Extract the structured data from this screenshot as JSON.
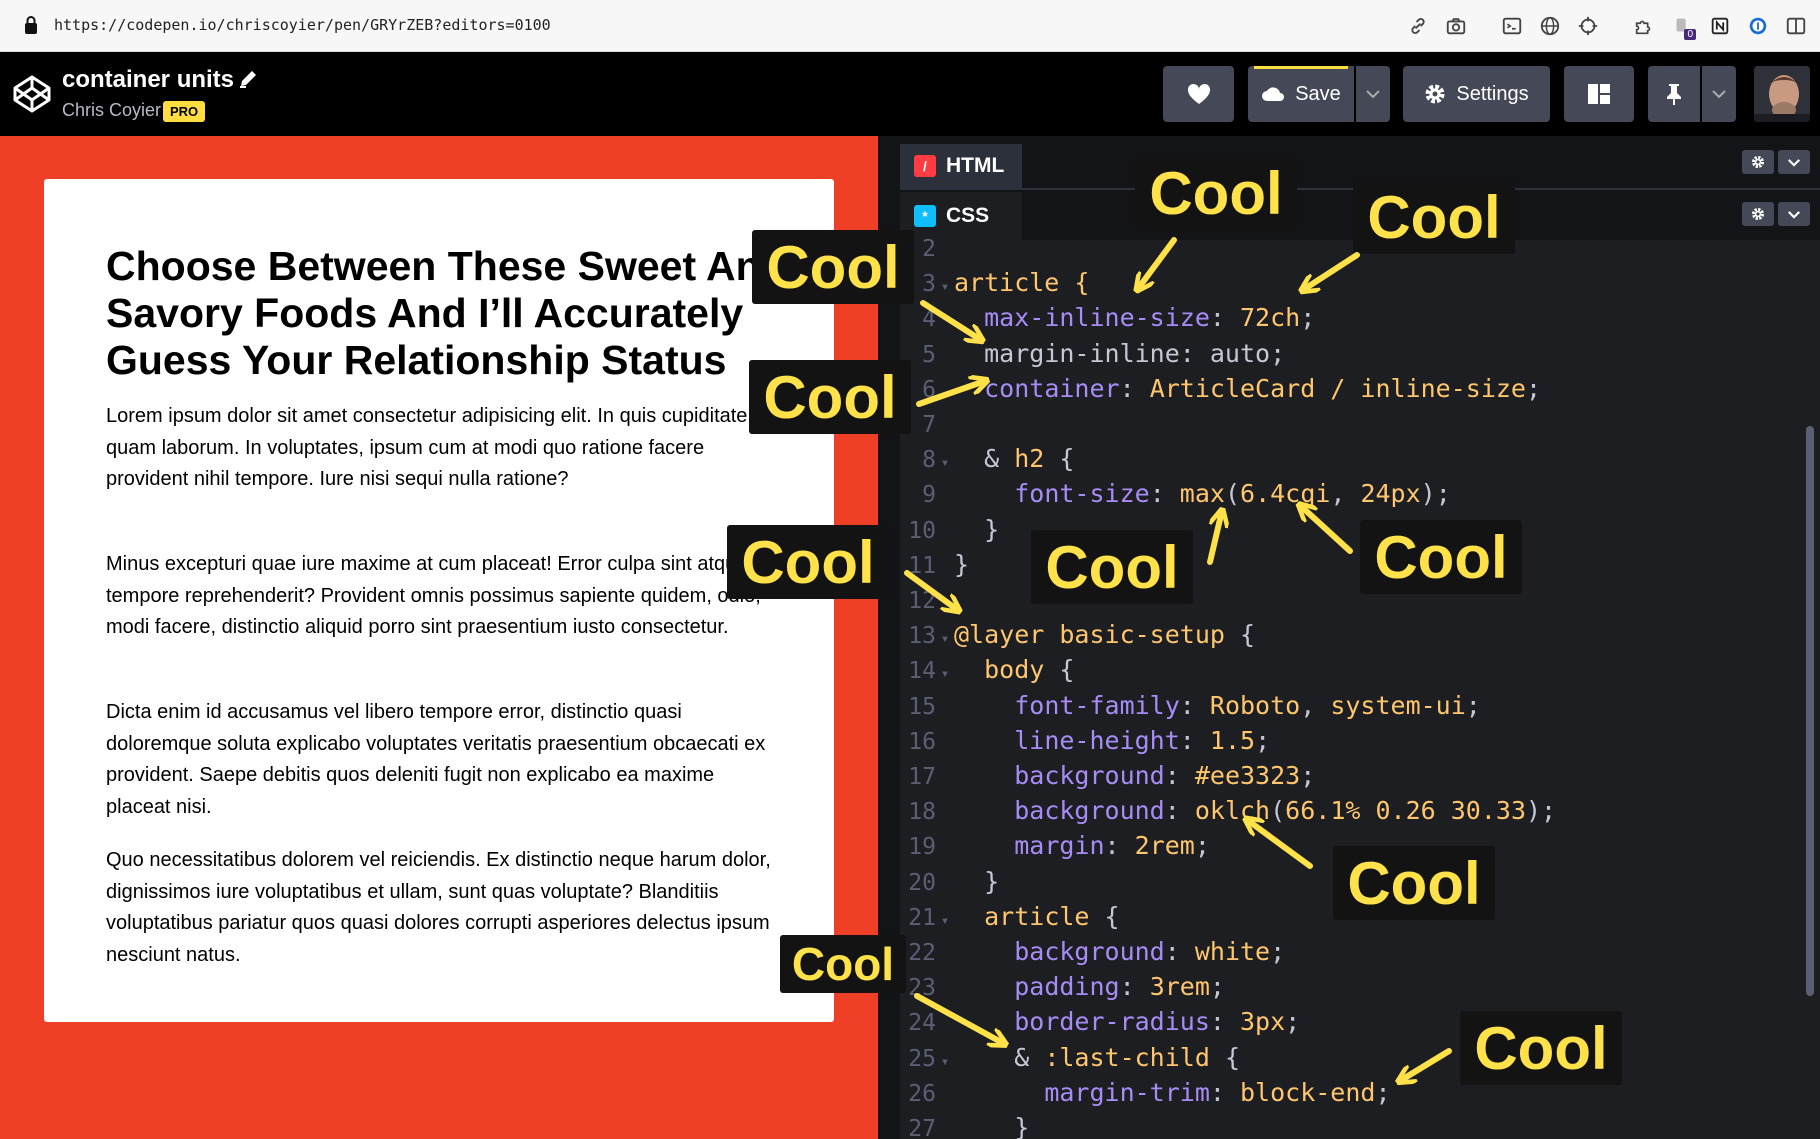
{
  "browser": {
    "url": "https://codepen.io/chriscoyier/pen/GRYrZEB?editors=0100",
    "extension_badge": "0"
  },
  "header": {
    "pen_title": "container units",
    "author": "Chris Coyier",
    "pro_badge": "PRO",
    "save_label": "Save",
    "settings_label": "Settings"
  },
  "preview": {
    "title": "Choose Between These Sweet And Savory Foods And I’ll Accurately Guess Your Relationship Status",
    "paragraphs": [
      "Lorem ipsum dolor sit amet consectetur adipisicing elit. In quis cupiditate quam laborum. In voluptates, ipsum cum at modi quo ratione facere provident nihil tempore. Iure nisi sequi nulla ratione?",
      "Minus excepturi quae iure maxime at cum placeat! Error culpa sint atque tempore reprehenderit? Provident omnis possimus sapiente quidem, odio, modi facere, distinctio aliquid porro sint praesentium iusto consectetur.",
      "Dicta enim id accusamus vel libero tempore error, distinctio quasi doloremque soluta explicabo voluptates veritatis praesentium obcaecati ex provident. Saepe debitis quos deleniti fugit non explicabo ea maxime placeat nisi.",
      "Quo necessitatibus dolorem vel reiciendis. Ex distinctio neque harum dolor, dignissimos iure voluptatibus et ullam, sunt quas voluptate? Blanditiis voluptatibus pariatur quos quasi dolores corrupti asperiores delectus ipsum nesciunt natus."
    ]
  },
  "editor": {
    "tab_html": "HTML",
    "tab_css": "CSS",
    "colors": {
      "property": "#a88cf5",
      "value": "#ffc66d",
      "plain": "#c5c8d4",
      "keyword": "#ffc66d",
      "line_number": "#5a5f73"
    },
    "lines": [
      {
        "n": "2",
        "fold": false,
        "tokens": [
          {
            "t": "",
            "c": "plain"
          }
        ]
      },
      {
        "n": "3",
        "fold": true,
        "tokens": [
          {
            "t": "article {",
            "c": "value"
          }
        ]
      },
      {
        "n": "4",
        "fold": false,
        "tokens": [
          {
            "t": "  ",
            "c": "plain"
          },
          {
            "t": "max-inline-size",
            "c": "property"
          },
          {
            "t": ": ",
            "c": "plain"
          },
          {
            "t": "72ch",
            "c": "value"
          },
          {
            "t": ";",
            "c": "plain"
          }
        ]
      },
      {
        "n": "5",
        "fold": false,
        "tokens": [
          {
            "t": "  margin-inline: auto;",
            "c": "plain"
          }
        ]
      },
      {
        "n": "6",
        "fold": false,
        "tokens": [
          {
            "t": "  ",
            "c": "plain"
          },
          {
            "t": "container",
            "c": "property"
          },
          {
            "t": ": ",
            "c": "plain"
          },
          {
            "t": "ArticleCard / inline-size",
            "c": "value"
          },
          {
            "t": ";",
            "c": "plain"
          }
        ]
      },
      {
        "n": "7",
        "fold": false,
        "tokens": [
          {
            "t": "",
            "c": "plain"
          }
        ]
      },
      {
        "n": "8",
        "fold": true,
        "tokens": [
          {
            "t": "  & ",
            "c": "plain"
          },
          {
            "t": "h2",
            "c": "value"
          },
          {
            "t": " {",
            "c": "plain"
          }
        ]
      },
      {
        "n": "9",
        "fold": false,
        "tokens": [
          {
            "t": "    ",
            "c": "plain"
          },
          {
            "t": "font-size",
            "c": "property"
          },
          {
            "t": ": ",
            "c": "plain"
          },
          {
            "t": "max",
            "c": "value"
          },
          {
            "t": "(",
            "c": "plain"
          },
          {
            "t": "6.4cqi",
            "c": "value"
          },
          {
            "t": ", ",
            "c": "plain"
          },
          {
            "t": "24px",
            "c": "value"
          },
          {
            "t": ");",
            "c": "plain"
          }
        ]
      },
      {
        "n": "10",
        "fold": false,
        "tokens": [
          {
            "t": "  }",
            "c": "plain"
          }
        ]
      },
      {
        "n": "11",
        "fold": false,
        "tokens": [
          {
            "t": "}",
            "c": "plain"
          }
        ]
      },
      {
        "n": "12",
        "fold": false,
        "tokens": [
          {
            "t": "",
            "c": "plain"
          }
        ]
      },
      {
        "n": "13",
        "fold": true,
        "tokens": [
          {
            "t": "@layer basic-setup",
            "c": "value"
          },
          {
            "t": " {",
            "c": "plain"
          }
        ]
      },
      {
        "n": "14",
        "fold": true,
        "tokens": [
          {
            "t": "  ",
            "c": "plain"
          },
          {
            "t": "body",
            "c": "value"
          },
          {
            "t": " {",
            "c": "plain"
          }
        ]
      },
      {
        "n": "15",
        "fold": false,
        "tokens": [
          {
            "t": "    ",
            "c": "plain"
          },
          {
            "t": "font-family",
            "c": "property"
          },
          {
            "t": ": ",
            "c": "plain"
          },
          {
            "t": "Roboto",
            "c": "value"
          },
          {
            "t": ", ",
            "c": "plain"
          },
          {
            "t": "system-ui",
            "c": "value"
          },
          {
            "t": ";",
            "c": "plain"
          }
        ]
      },
      {
        "n": "16",
        "fold": false,
        "tokens": [
          {
            "t": "    ",
            "c": "plain"
          },
          {
            "t": "line-height",
            "c": "property"
          },
          {
            "t": ": ",
            "c": "plain"
          },
          {
            "t": "1.5",
            "c": "value"
          },
          {
            "t": ";",
            "c": "plain"
          }
        ]
      },
      {
        "n": "17",
        "fold": false,
        "tokens": [
          {
            "t": "    ",
            "c": "plain"
          },
          {
            "t": "background",
            "c": "property"
          },
          {
            "t": ": ",
            "c": "plain"
          },
          {
            "t": "#ee3323",
            "c": "value"
          },
          {
            "t": ";",
            "c": "plain"
          }
        ]
      },
      {
        "n": "18",
        "fold": false,
        "tokens": [
          {
            "t": "    ",
            "c": "plain"
          },
          {
            "t": "background",
            "c": "property"
          },
          {
            "t": ": ",
            "c": "plain"
          },
          {
            "t": "oklch",
            "c": "value"
          },
          {
            "t": "(",
            "c": "plain"
          },
          {
            "t": "66.1% 0.26 30.33",
            "c": "value"
          },
          {
            "t": ");",
            "c": "plain"
          }
        ]
      },
      {
        "n": "19",
        "fold": false,
        "tokens": [
          {
            "t": "    ",
            "c": "plain"
          },
          {
            "t": "margin",
            "c": "property"
          },
          {
            "t": ": ",
            "c": "plain"
          },
          {
            "t": "2rem",
            "c": "value"
          },
          {
            "t": ";",
            "c": "plain"
          }
        ]
      },
      {
        "n": "20",
        "fold": false,
        "tokens": [
          {
            "t": "  }",
            "c": "plain"
          }
        ]
      },
      {
        "n": "21",
        "fold": true,
        "tokens": [
          {
            "t": "  ",
            "c": "plain"
          },
          {
            "t": "article",
            "c": "value"
          },
          {
            "t": " {",
            "c": "plain"
          }
        ]
      },
      {
        "n": "22",
        "fold": false,
        "tokens": [
          {
            "t": "    ",
            "c": "plain"
          },
          {
            "t": "background",
            "c": "property"
          },
          {
            "t": ": ",
            "c": "plain"
          },
          {
            "t": "white",
            "c": "value"
          },
          {
            "t": ";",
            "c": "plain"
          }
        ]
      },
      {
        "n": "23",
        "fold": false,
        "tokens": [
          {
            "t": "    ",
            "c": "plain"
          },
          {
            "t": "padding",
            "c": "property"
          },
          {
            "t": ": ",
            "c": "plain"
          },
          {
            "t": "3rem",
            "c": "value"
          },
          {
            "t": ";",
            "c": "plain"
          }
        ]
      },
      {
        "n": "24",
        "fold": false,
        "tokens": [
          {
            "t": "    ",
            "c": "plain"
          },
          {
            "t": "border-radius",
            "c": "property"
          },
          {
            "t": ": ",
            "c": "plain"
          },
          {
            "t": "3px",
            "c": "value"
          },
          {
            "t": ";",
            "c": "plain"
          }
        ]
      },
      {
        "n": "25",
        "fold": true,
        "tokens": [
          {
            "t": "    & ",
            "c": "plain"
          },
          {
            "t": ":last-child",
            "c": "value"
          },
          {
            "t": " {",
            "c": "plain"
          }
        ]
      },
      {
        "n": "26",
        "fold": false,
        "tokens": [
          {
            "t": "      ",
            "c": "plain"
          },
          {
            "t": "margin-trim",
            "c": "property"
          },
          {
            "t": ": ",
            "c": "plain"
          },
          {
            "t": "block-end",
            "c": "value"
          },
          {
            "t": ";",
            "c": "plain"
          }
        ]
      },
      {
        "n": "27",
        "fold": false,
        "tokens": [
          {
            "t": "    }",
            "c": "plain"
          }
        ]
      }
    ]
  },
  "annotations": {
    "label": "Cool",
    "color": "#ffe14a",
    "callouts": [
      "Cool",
      "Cool",
      "Cool",
      "Cool",
      "Cool",
      "Cool",
      "Cool",
      "Cool",
      "Cool",
      "Cool"
    ]
  }
}
